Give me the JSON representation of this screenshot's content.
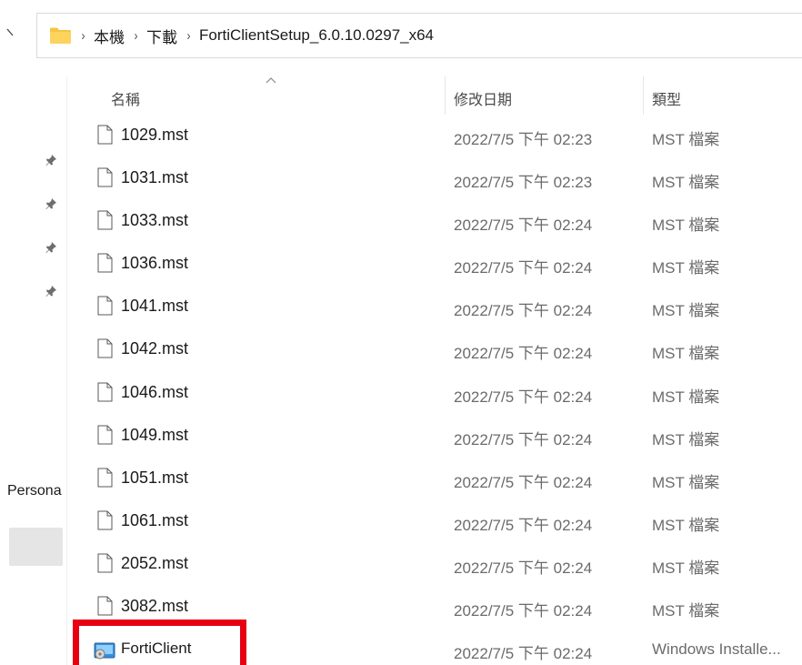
{
  "address_bar": {
    "breadcrumbs": [
      "本機",
      "下載",
      "FortiClientSetup_6.0.10.0297_x64"
    ],
    "separator": "›"
  },
  "nav_pane": {
    "pinned_icon": "pin-icon",
    "visible_label": "Persona"
  },
  "columns": {
    "name": "名稱",
    "date": "修改日期",
    "type": "類型"
  },
  "files": [
    {
      "name": "1029.mst",
      "date": "2022/7/5 下午 02:23",
      "type": "MST 檔案",
      "icon": "file-icon"
    },
    {
      "name": "1031.mst",
      "date": "2022/7/5 下午 02:23",
      "type": "MST 檔案",
      "icon": "file-icon"
    },
    {
      "name": "1033.mst",
      "date": "2022/7/5 下午 02:24",
      "type": "MST 檔案",
      "icon": "file-icon"
    },
    {
      "name": "1036.mst",
      "date": "2022/7/5 下午 02:24",
      "type": "MST 檔案",
      "icon": "file-icon"
    },
    {
      "name": "1041.mst",
      "date": "2022/7/5 下午 02:24",
      "type": "MST 檔案",
      "icon": "file-icon"
    },
    {
      "name": "1042.mst",
      "date": "2022/7/5 下午 02:24",
      "type": "MST 檔案",
      "icon": "file-icon"
    },
    {
      "name": "1046.mst",
      "date": "2022/7/5 下午 02:24",
      "type": "MST 檔案",
      "icon": "file-icon"
    },
    {
      "name": "1049.mst",
      "date": "2022/7/5 下午 02:24",
      "type": "MST 檔案",
      "icon": "file-icon"
    },
    {
      "name": "1051.mst",
      "date": "2022/7/5 下午 02:24",
      "type": "MST 檔案",
      "icon": "file-icon"
    },
    {
      "name": "1061.mst",
      "date": "2022/7/5 下午 02:24",
      "type": "MST 檔案",
      "icon": "file-icon"
    },
    {
      "name": "2052.mst",
      "date": "2022/7/5 下午 02:24",
      "type": "MST 檔案",
      "icon": "file-icon"
    },
    {
      "name": "3082.mst",
      "date": "2022/7/5 下午 02:24",
      "type": "MST 檔案",
      "icon": "file-icon"
    },
    {
      "name": "FortiClient",
      "date": "2022/7/5 下午 02:24",
      "type": "Windows Installe...",
      "icon": "windows-installer-icon"
    }
  ],
  "colors": {
    "highlight": "#e60012",
    "folder": "#f5c542",
    "selection": "#e5e5e5"
  }
}
